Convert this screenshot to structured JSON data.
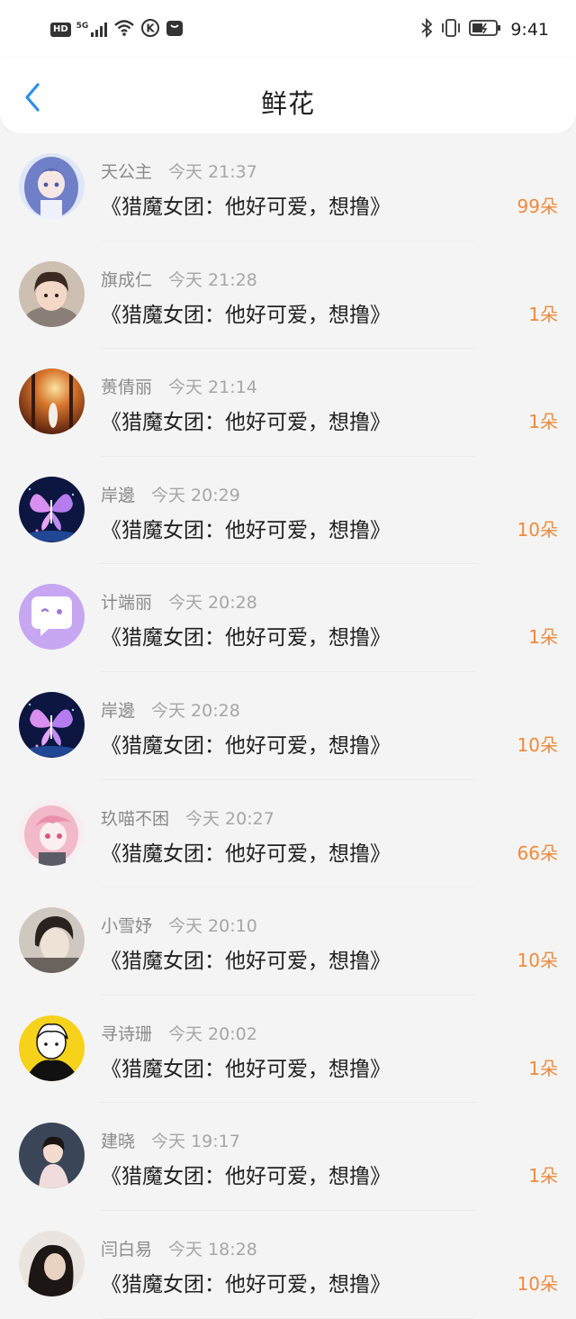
{
  "status_bar": {
    "time": "9:41",
    "signal_label": "5G",
    "hd_label": "HD",
    "k_label": "K"
  },
  "header": {
    "title": "鲜花"
  },
  "colors": {
    "accent": "#2b8ff0",
    "count": "#ef8a3c"
  },
  "items": [
    {
      "name": "天公主",
      "time": "今天 21:37",
      "message": "《猎魔女团：他好可爱，想撸》",
      "count": "99朵",
      "avatar": "anime-girl-blue"
    },
    {
      "name": "旗成仁",
      "time": "今天 21:28",
      "message": "《猎魔女团：他好可爱，想撸》",
      "count": "1朵",
      "avatar": "child-photo"
    },
    {
      "name": "蒉倩丽",
      "time": "今天 21:14",
      "message": "《猎魔女团：他好可爱，想撸》",
      "count": "1朵",
      "avatar": "autumn-forest"
    },
    {
      "name": "岸邊",
      "time": "今天 20:29",
      "message": "《猎魔女团：他好可爱，想撸》",
      "count": "10朵",
      "avatar": "butterfly"
    },
    {
      "name": "计端丽",
      "time": "今天 20:28",
      "message": "《猎魔女团：他好可爱，想撸》",
      "count": "1朵",
      "avatar": "chat-bubble-purple"
    },
    {
      "name": "岸邊",
      "time": "今天 20:28",
      "message": "《猎魔女团：他好可爱，想撸》",
      "count": "10朵",
      "avatar": "butterfly"
    },
    {
      "name": "玖喵不困",
      "time": "今天 20:27",
      "message": "《猎魔女团：他好可爱，想撸》",
      "count": "66朵",
      "avatar": "anime-girl-pink"
    },
    {
      "name": "小雪妤",
      "time": "今天 20:10",
      "message": "《猎魔女团：他好可爱，想撸》",
      "count": "10朵",
      "avatar": "portrait-bw"
    },
    {
      "name": "寻诗珊",
      "time": "今天 20:02",
      "message": "《猎魔女团：他好可爱，想撸》",
      "count": "1朵",
      "avatar": "manga-yellow"
    },
    {
      "name": "建晓",
      "time": "今天 19:17",
      "message": "《猎魔女团：他好可爱，想撸》",
      "count": "1朵",
      "avatar": "girl-photo"
    },
    {
      "name": "闫白易",
      "time": "今天 18:28",
      "message": "《猎魔女团：他好可爱，想撸》",
      "count": "10朵",
      "avatar": "portrait-dark"
    }
  ]
}
